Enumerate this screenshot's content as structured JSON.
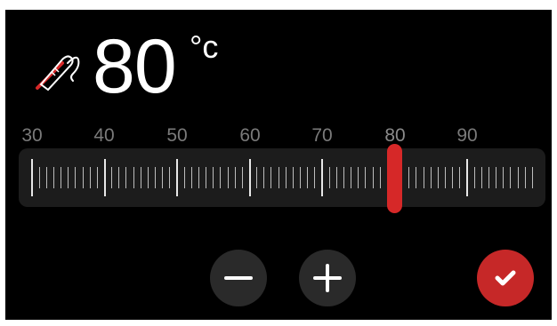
{
  "temperature": {
    "value": "80",
    "unit": "°c"
  },
  "scale": {
    "labels": [
      "30",
      "40",
      "50",
      "60",
      "70",
      "80",
      "90"
    ],
    "selected": 80
  },
  "icons": {
    "probe": "thermometer-probe-icon",
    "minus": "minus-icon",
    "plus": "plus-icon",
    "confirm": "checkmark-icon"
  },
  "colors": {
    "background": "#000000",
    "accent": "#d62828",
    "track": "#1c1c1c",
    "button": "#2a2a2a",
    "label": "#7a7a7a"
  }
}
